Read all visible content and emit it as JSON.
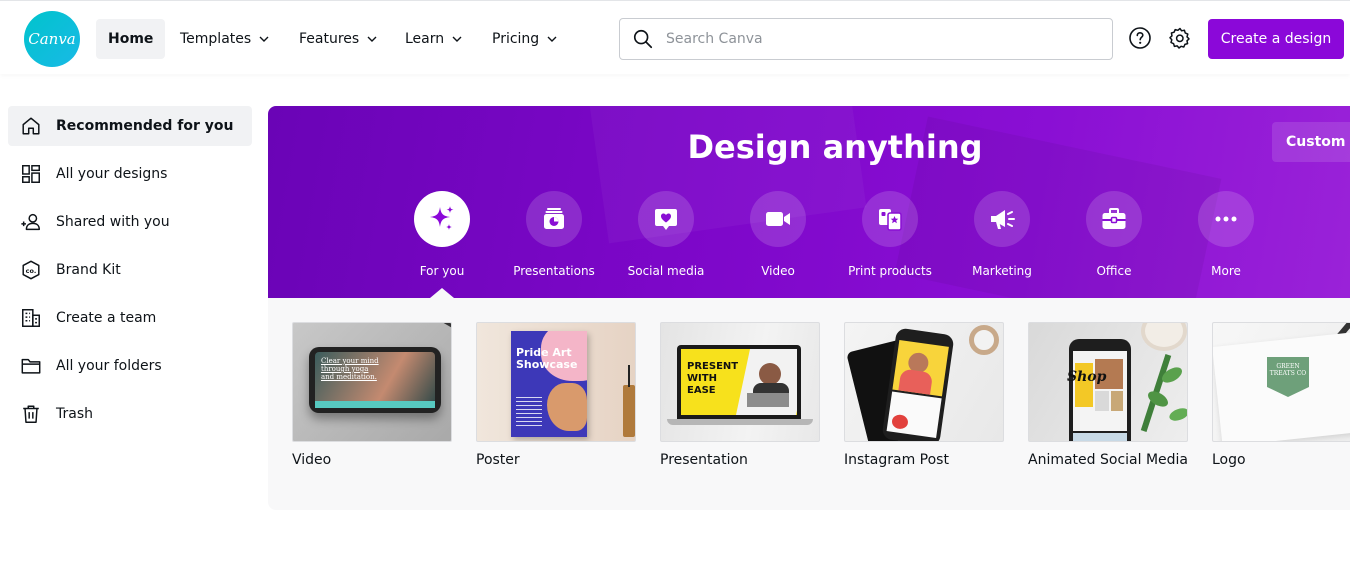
{
  "header": {
    "logo_text": "Canva",
    "nav": [
      {
        "label": "Home",
        "active": true,
        "has_chevron": false
      },
      {
        "label": "Templates",
        "has_chevron": true
      },
      {
        "label": "Features",
        "has_chevron": true
      },
      {
        "label": "Learn",
        "has_chevron": true
      },
      {
        "label": "Pricing",
        "has_chevron": true
      }
    ],
    "search": {
      "placeholder": "Search Canva",
      "value": ""
    },
    "help_icon": "help-circle-icon",
    "settings_icon": "gear-icon",
    "create_button": "Create a design",
    "accent_color": "#8b08d9"
  },
  "sidebar": {
    "items": [
      {
        "label": "Recommended for you",
        "icon": "home-icon",
        "active": true
      },
      {
        "label": "All your designs",
        "icon": "grid-icon"
      },
      {
        "label": "Shared with you",
        "icon": "shared-users-icon"
      },
      {
        "label": "Brand Kit",
        "icon": "brand-kit-icon"
      },
      {
        "label": "Create a team",
        "icon": "building-icon"
      },
      {
        "label": "All your folders",
        "icon": "folder-icon"
      },
      {
        "label": "Trash",
        "icon": "trash-icon"
      }
    ]
  },
  "hero": {
    "title": "Design anything",
    "custom_size_button": "Custom s",
    "categories": [
      {
        "label": "For you",
        "icon": "sparkle-icon",
        "active": true
      },
      {
        "label": "Presentations",
        "icon": "presentation-icon"
      },
      {
        "label": "Social media",
        "icon": "heart-chat-icon"
      },
      {
        "label": "Video",
        "icon": "video-camera-icon"
      },
      {
        "label": "Print products",
        "icon": "print-products-icon"
      },
      {
        "label": "Marketing",
        "icon": "megaphone-icon"
      },
      {
        "label": "Office",
        "icon": "briefcase-icon"
      },
      {
        "label": "More",
        "icon": "more-dots-icon"
      }
    ]
  },
  "designs": {
    "cards": [
      {
        "label": "Video",
        "thumb_text": "Clear your mind through yoga and meditation."
      },
      {
        "label": "Poster",
        "thumb_text": "Pride Art Showcase"
      },
      {
        "label": "Presentation",
        "thumb_text": "PRESENT WITH EASE"
      },
      {
        "label": "Instagram Post",
        "thumb_text": ""
      },
      {
        "label": "Animated Social Media",
        "thumb_text": "Shop"
      },
      {
        "label": "Logo",
        "thumb_text": "GREEN TREATS CO"
      }
    ]
  }
}
